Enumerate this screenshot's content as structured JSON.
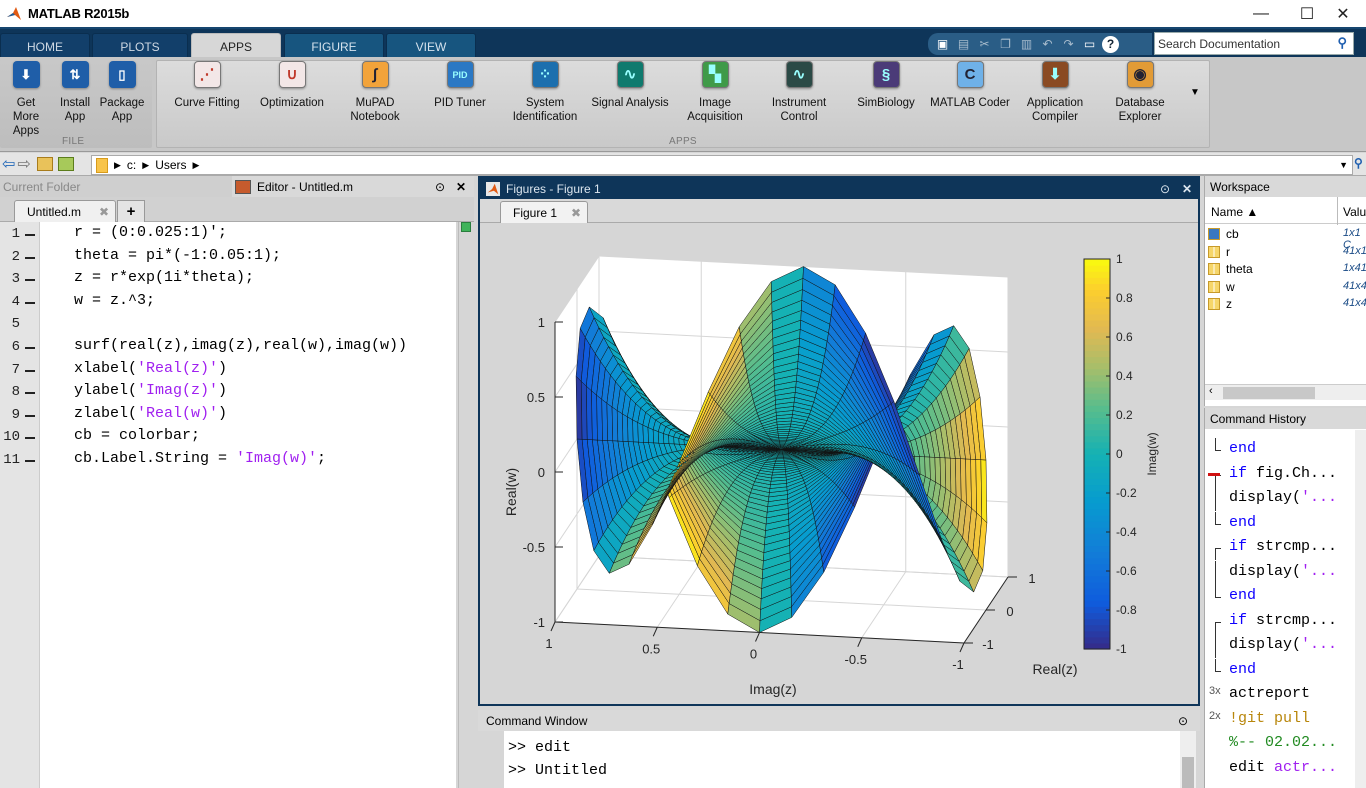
{
  "app": {
    "title": "MATLAB R2015b"
  },
  "window_controls": {
    "minimize": "—",
    "maximize": "☐",
    "close": "✕"
  },
  "ribbon_tabs": [
    {
      "label": "HOME",
      "active": false
    },
    {
      "label": "PLOTS",
      "active": false
    },
    {
      "label": "APPS",
      "active": true
    },
    {
      "label": "FIGURE",
      "active": false
    },
    {
      "label": "VIEW",
      "active": false
    }
  ],
  "quick_access": [
    "new-icon",
    "save-icon",
    "cut-icon",
    "copy-icon",
    "paste-icon",
    "undo-icon",
    "redo-icon",
    "switch-windows-icon",
    "help-icon"
  ],
  "search": {
    "placeholder": "Search Documentation"
  },
  "ribbon": {
    "file_group": {
      "label": "FILE",
      "buttons": [
        {
          "label": "Get More Apps",
          "icon": "download-icon",
          "color": "#1f5ea8"
        },
        {
          "label": "Install App",
          "icon": "install-icon",
          "color": "#1f5ea8"
        },
        {
          "label": "Package App",
          "icon": "package-icon",
          "color": "#1f5ea8"
        }
      ]
    },
    "apps_group": {
      "label": "APPS",
      "buttons": [
        {
          "label": "Curve Fitting",
          "icon": "curve-fitting-icon",
          "color": "#f3e7e7"
        },
        {
          "label": "Optimization",
          "icon": "optimization-icon",
          "color": "#f3e7e7"
        },
        {
          "label": "MuPAD Notebook",
          "icon": "mupad-icon",
          "color": "#f2a33a"
        },
        {
          "label": "PID Tuner",
          "icon": "pid-tuner-icon",
          "color": "#2b78c4"
        },
        {
          "label": "System Identification",
          "icon": "system-id-icon",
          "color": "#1c6fae"
        },
        {
          "label": "Signal Analysis",
          "icon": "signal-analysis-icon",
          "color": "#0f7a6e"
        },
        {
          "label": "Image Acquisition",
          "icon": "image-acquisition-icon",
          "color": "#3f9a48"
        },
        {
          "label": "Instrument Control",
          "icon": "instrument-control-icon",
          "color": "#2b4a46"
        },
        {
          "label": "SimBiology",
          "icon": "simbiology-icon",
          "color": "#4b3b78"
        },
        {
          "label": "MATLAB Coder",
          "icon": "matlab-coder-icon",
          "color": "#6fb1e8"
        },
        {
          "label": "Application Compiler",
          "icon": "app-compiler-icon",
          "color": "#8a4a22"
        },
        {
          "label": "Database Explorer",
          "icon": "database-explorer-icon",
          "color": "#e29b36"
        }
      ]
    }
  },
  "address": {
    "path": [
      "c:",
      "Users"
    ]
  },
  "current_folder": {
    "title": "Current Folder"
  },
  "editor": {
    "title": "Editor - Untitled.m",
    "tab": "Untitled.m",
    "add_tab": "+",
    "lines": [
      {
        "n": "1",
        "exec": true,
        "parts": [
          {
            "t": "r = (0:0.025:1)';",
            "c": ""
          }
        ]
      },
      {
        "n": "2",
        "exec": true,
        "parts": [
          {
            "t": "theta = pi*(-1:0.05:1);",
            "c": ""
          }
        ]
      },
      {
        "n": "3",
        "exec": true,
        "parts": [
          {
            "t": "z = r*exp(1i*theta);",
            "c": ""
          }
        ]
      },
      {
        "n": "4",
        "exec": true,
        "parts": [
          {
            "t": "w = z.^3;",
            "c": ""
          }
        ]
      },
      {
        "n": "5",
        "exec": false,
        "parts": []
      },
      {
        "n": "6",
        "exec": true,
        "parts": [
          {
            "t": "surf(real(z),imag(z),real(w),imag(w))",
            "c": ""
          }
        ]
      },
      {
        "n": "7",
        "exec": true,
        "parts": [
          {
            "t": "xlabel(",
            "c": ""
          },
          {
            "t": "'Real(z)'",
            "c": "str"
          },
          {
            "t": ")",
            "c": ""
          }
        ]
      },
      {
        "n": "8",
        "exec": true,
        "parts": [
          {
            "t": "ylabel(",
            "c": ""
          },
          {
            "t": "'Imag(z)'",
            "c": "str"
          },
          {
            "t": ")",
            "c": ""
          }
        ]
      },
      {
        "n": "9",
        "exec": true,
        "parts": [
          {
            "t": "zlabel(",
            "c": ""
          },
          {
            "t": "'Real(w)'",
            "c": "str"
          },
          {
            "t": ")",
            "c": ""
          }
        ]
      },
      {
        "n": "10",
        "exec": true,
        "parts": [
          {
            "t": "cb = colorbar;",
            "c": ""
          }
        ]
      },
      {
        "n": "11",
        "exec": true,
        "parts": [
          {
            "t": "cb.Label.String = ",
            "c": ""
          },
          {
            "t": "'Imag(w)'",
            "c": "str"
          },
          {
            "t": ";",
            "c": ""
          }
        ]
      }
    ]
  },
  "figures": {
    "title": "Figures - Figure 1",
    "tab": "Figure 1"
  },
  "chart_data": {
    "type": "surface",
    "title": "",
    "function": "w = z.^3, z = r*exp(1i*theta)",
    "r": {
      "start": 0,
      "step": 0.025,
      "end": 1
    },
    "theta_over_pi": {
      "start": -1,
      "step": 0.05,
      "end": 1
    },
    "x": "real(z)",
    "y": "imag(z)",
    "z": "real(w)",
    "color": "imag(w)",
    "xlabel": "Real(z)",
    "ylabel": "Imag(z)",
    "zlabel": "Real(w)",
    "xlim": [
      -1,
      1
    ],
    "ylim": [
      -1,
      1
    ],
    "zlim": [
      -1,
      1
    ],
    "xticks": [
      "-1",
      "0",
      "1"
    ],
    "yticks": [
      "1",
      "0.5",
      "0",
      "-0.5",
      "-1"
    ],
    "zticks": [
      "1",
      "0.5",
      "0",
      "-0.5",
      "-1"
    ],
    "colorbar": {
      "label": "Imag(w)",
      "limits": [
        -1,
        1
      ],
      "ticks": [
        "1",
        "0.8",
        "0.6",
        "0.4",
        "0.2",
        "0",
        "-0.2",
        "-0.4",
        "-0.6",
        "-0.8",
        "-1"
      ]
    },
    "colormap": "parula",
    "grid": true
  },
  "command_window": {
    "title": "Command Window",
    "lines": [
      ">> edit",
      ">> Untitled"
    ]
  },
  "workspace": {
    "title": "Workspace",
    "columns": [
      "Name ▲",
      "Valu"
    ],
    "rows": [
      {
        "name": "cb",
        "value": "1x1 C",
        "icon": "object-icon"
      },
      {
        "name": "r",
        "value": "41x1",
        "icon": "matrix-icon"
      },
      {
        "name": "theta",
        "value": "1x41",
        "icon": "matrix-icon"
      },
      {
        "name": "w",
        "value": "41x4",
        "icon": "matrix-icon"
      },
      {
        "name": "z",
        "value": "41x4",
        "icon": "matrix-icon"
      }
    ]
  },
  "command_history": {
    "title": "Command History",
    "items": [
      {
        "prefix": "",
        "bracket": "end",
        "parts": [
          {
            "t": "end",
            "c": "kw"
          }
        ]
      },
      {
        "prefix": "",
        "bracket": "start",
        "marker": true,
        "parts": [
          {
            "t": "if",
            "c": "kw"
          },
          {
            "t": " fig.Ch...",
            "c": ""
          }
        ]
      },
      {
        "prefix": "",
        "bracket": "mid",
        "parts": [
          {
            "t": "display(",
            "c": ""
          },
          {
            "t": "'...",
            "c": "str"
          }
        ]
      },
      {
        "prefix": "",
        "bracket": "end",
        "parts": [
          {
            "t": "end",
            "c": "kw"
          }
        ]
      },
      {
        "prefix": "",
        "bracket": "start",
        "parts": [
          {
            "t": "if",
            "c": "kw"
          },
          {
            "t": " strcmp...",
            "c": ""
          }
        ]
      },
      {
        "prefix": "",
        "bracket": "mid",
        "parts": [
          {
            "t": "display(",
            "c": ""
          },
          {
            "t": "'...",
            "c": "str"
          }
        ]
      },
      {
        "prefix": "",
        "bracket": "end",
        "parts": [
          {
            "t": "end",
            "c": "kw"
          }
        ]
      },
      {
        "prefix": "",
        "bracket": "start",
        "parts": [
          {
            "t": "if",
            "c": "kw"
          },
          {
            "t": " strcmp...",
            "c": ""
          }
        ]
      },
      {
        "prefix": "",
        "bracket": "mid",
        "parts": [
          {
            "t": "display(",
            "c": ""
          },
          {
            "t": "'...",
            "c": "str"
          }
        ]
      },
      {
        "prefix": "",
        "bracket": "end",
        "parts": [
          {
            "t": "end",
            "c": "kw"
          }
        ]
      },
      {
        "prefix": "3x",
        "bracket": "",
        "parts": [
          {
            "t": "actreport",
            "c": ""
          }
        ]
      },
      {
        "prefix": "2x",
        "bracket": "",
        "parts": [
          {
            "t": "!git pull",
            "c": "sh"
          }
        ]
      },
      {
        "prefix": "",
        "bracket": "",
        "parts": [
          {
            "t": "%-- 02.02...",
            "c": "cmt"
          }
        ]
      },
      {
        "prefix": "",
        "bracket": "",
        "parts": [
          {
            "t": "edit ",
            "c": ""
          },
          {
            "t": "actr...",
            "c": "str"
          }
        ]
      }
    ]
  }
}
